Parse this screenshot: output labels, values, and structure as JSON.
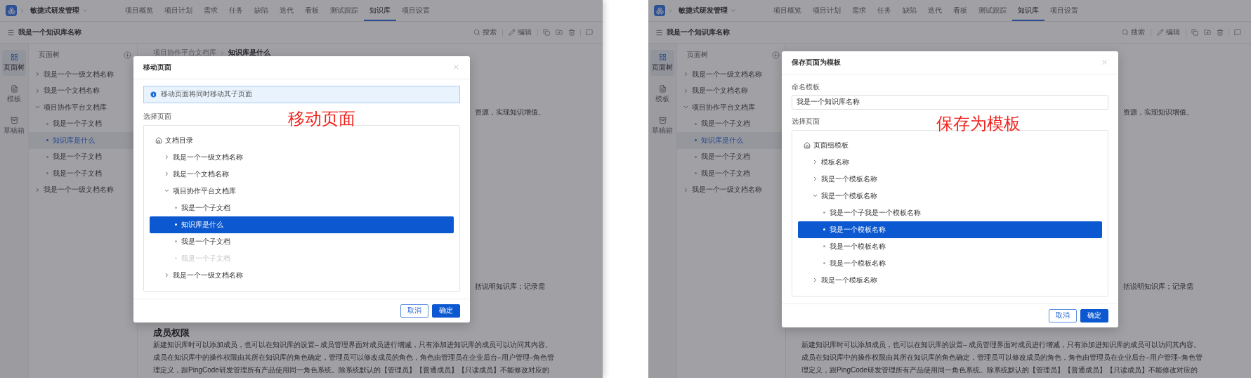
{
  "screens": [
    {
      "app_bar": {
        "product": "敏捷式研发管理",
        "nav": [
          {
            "label": "项目概览",
            "selected": false
          },
          {
            "label": "项目计划",
            "selected": false
          },
          {
            "label": "需求",
            "selected": false
          },
          {
            "label": "任务",
            "selected": false
          },
          {
            "label": "缺陷",
            "selected": false
          },
          {
            "label": "迭代",
            "selected": false
          },
          {
            "label": "看板",
            "selected": false
          },
          {
            "label": "测试跟踪",
            "selected": false
          },
          {
            "label": "知识库",
            "selected": true
          },
          {
            "label": "项目设置",
            "selected": false
          }
        ]
      },
      "toolbar": {
        "title": "我是一个知识库名称",
        "actions": [
          {
            "label": "搜索",
            "kind": "search"
          },
          {
            "label": "编辑",
            "kind": "edit"
          }
        ]
      },
      "rail": [
        {
          "label": "页面树",
          "kind": "tree",
          "selected": true
        },
        {
          "label": "模板",
          "kind": "template",
          "selected": false
        },
        {
          "label": "草稿箱",
          "kind": "drafts",
          "selected": false
        }
      ],
      "tree_panel": {
        "title": "页面树",
        "items": [
          {
            "label": "我是一个一级文档名称",
            "kind": "branch",
            "expanded": false,
            "selected": false
          },
          {
            "label": "我是一个文档名称",
            "kind": "branch",
            "expanded": false,
            "selected": false
          },
          {
            "label": "项目协作平台文档库",
            "kind": "branch",
            "expanded": true,
            "selected": false,
            "children": [
              {
                "label": "我是一个子文档",
                "kind": "leaf",
                "selected": false
              },
              {
                "label": "知识库是什么",
                "kind": "leaf",
                "selected": true
              },
              {
                "label": "我是一个子文档",
                "kind": "leaf",
                "selected": false
              },
              {
                "label": "我是一个子文档",
                "kind": "leaf",
                "selected": false
              }
            ]
          },
          {
            "label": "我是一个一级文档名称",
            "kind": "branch",
            "expanded": false,
            "selected": false
          }
        ]
      },
      "content": {
        "breadcrumb": [
          "项目协作平台文档库",
          "知识库是什么"
        ],
        "fragments": [
          "资源，实现知识增值。",
          "括说明知识库；记录需"
        ],
        "heading": "成员权限",
        "paragraph": [
          "新建知识库时可以添加成员，也可以在知识库的设置– 成员管理界面对成员进行增减，只有添加进知识库的成员可以访问其内容。",
          "成员在知识库中的操作权限由其所在知识库的角色确定，管理员可以修改成员的角色，角色由管理员在企业后台–用户管理–角色管",
          "理定义，跟PingCode研发管理所有产品使用同一角色系统。除系统默认的【管理员】【普通成员】【只读成员】不能修改对应的"
        ]
      },
      "dialog": {
        "title": "移动页面",
        "alert": "移动页面将同时移动其子页面",
        "tree_label": "选择页面",
        "annotation": "移动页面",
        "tree": {
          "label": "文档目录",
          "kind": "root",
          "selected": false,
          "disabled": false,
          "children": [
            {
              "label": "我是一个一级文档名称",
              "kind": "branch",
              "expanded": false,
              "selected": false,
              "disabled": false
            },
            {
              "label": "我是一个文档名称",
              "kind": "branch",
              "expanded": false,
              "selected": false,
              "disabled": false
            },
            {
              "label": "项目协作平台文档库",
              "kind": "branch",
              "expanded": true,
              "selected": false,
              "disabled": false,
              "children": [
                {
                  "label": "我是一个子文档",
                  "kind": "leaf",
                  "selected": false,
                  "disabled": false
                },
                {
                  "label": "知识库是什么",
                  "kind": "leaf",
                  "selected": true,
                  "disabled": false
                },
                {
                  "label": "我是一个子文档",
                  "kind": "leaf",
                  "selected": false,
                  "disabled": false
                },
                {
                  "label": "我是一个子文档",
                  "kind": "leaf",
                  "selected": false,
                  "disabled": true
                }
              ]
            },
            {
              "label": "我是一个一级文档名称",
              "kind": "branch",
              "expanded": false,
              "selected": false,
              "disabled": false
            }
          ]
        },
        "buttons": [
          {
            "label": "取消",
            "kind": "secondary"
          },
          {
            "label": "确定",
            "kind": "primary"
          }
        ]
      }
    },
    {
      "app_bar": {
        "product": "敏捷式研发管理",
        "nav": [
          {
            "label": "项目概览",
            "selected": false
          },
          {
            "label": "项目计划",
            "selected": false
          },
          {
            "label": "需求",
            "selected": false
          },
          {
            "label": "任务",
            "selected": false
          },
          {
            "label": "缺陷",
            "selected": false
          },
          {
            "label": "迭代",
            "selected": false
          },
          {
            "label": "看板",
            "selected": false
          },
          {
            "label": "测试跟踪",
            "selected": false
          },
          {
            "label": "知识库",
            "selected": true
          },
          {
            "label": "项目设置",
            "selected": false
          }
        ]
      },
      "toolbar": {
        "title": "我是一个知识库名称",
        "actions": [
          {
            "label": "搜索",
            "kind": "search"
          },
          {
            "label": "编辑",
            "kind": "edit"
          }
        ]
      },
      "rail": [
        {
          "label": "页面树",
          "kind": "tree",
          "selected": true
        },
        {
          "label": "模板",
          "kind": "template",
          "selected": false
        },
        {
          "label": "草稿箱",
          "kind": "drafts",
          "selected": false
        }
      ],
      "tree_panel": {
        "title": "页面树",
        "items": [
          {
            "label": "我是一个一级文档名称",
            "kind": "branch",
            "expanded": false,
            "selected": false
          },
          {
            "label": "我是一个文档名称",
            "kind": "branch",
            "expanded": false,
            "selected": false
          },
          {
            "label": "项目协作平台文档库",
            "kind": "branch",
            "expanded": true,
            "selected": false,
            "children": [
              {
                "label": "我是一个子文档",
                "kind": "leaf",
                "selected": false
              },
              {
                "label": "知识库是什么",
                "kind": "leaf",
                "selected": true
              },
              {
                "label": "我是一个子文档",
                "kind": "leaf",
                "selected": false
              },
              {
                "label": "我是一个子文档",
                "kind": "leaf",
                "selected": false
              }
            ]
          },
          {
            "label": "我是一个一级文档名称",
            "kind": "branch",
            "expanded": false,
            "selected": false
          }
        ]
      },
      "content": {
        "fragments": [
          "资源，实现知识增值。",
          "括说明知识库；记录需"
        ],
        "paragraph": [
          "新建知识库时可以添加成员，也可以在知识库的设置– 成员管理界面对成员进行增减，只有添加进知识库的成员可以访问其内容。",
          "成员在知识库中的操作权限由其所在知识库的角色确定，管理员可以修改成员的角色，角色由管理员在企业后台–用户管理–角色管",
          "理定义，跟PingCode研发管理所有产品使用同一角色系统。除系统默认的【管理员】【普通成员】【只读成员】不能修改对应的"
        ]
      },
      "dialog": {
        "title": "保存页面为模板",
        "name_label": "命名模板",
        "name_value": "我是一个知识库名称",
        "tree_label": "选择页面",
        "annotation": "保存为模板",
        "tree": {
          "label": "页面组模板",
          "kind": "root",
          "selected": false,
          "disabled": false,
          "children": [
            {
              "label": "模板名称",
              "kind": "branch",
              "expanded": false,
              "selected": false,
              "disabled": false
            },
            {
              "label": "我是一个模板名称",
              "kind": "branch",
              "expanded": false,
              "selected": false,
              "disabled": false
            },
            {
              "label": "我是一个模板名称",
              "kind": "branch",
              "expanded": true,
              "selected": false,
              "disabled": false,
              "children": [
                {
                  "label": "我是一个子我是一个模板名称",
                  "kind": "leaf",
                  "selected": false,
                  "disabled": false
                },
                {
                  "label": "我是一个模板名称",
                  "kind": "leaf",
                  "selected": true,
                  "disabled": false
                },
                {
                  "label": "我是一个模板名称",
                  "kind": "leaf",
                  "selected": false,
                  "disabled": false
                },
                {
                  "label": "我是一个模板名称",
                  "kind": "leaf",
                  "selected": false,
                  "disabled": false
                }
              ]
            },
            {
              "label": "我是一个模板名称",
              "kind": "branch",
              "expanded": false,
              "selected": false,
              "disabled": false
            }
          ]
        },
        "buttons": [
          {
            "label": "取消",
            "kind": "secondary"
          },
          {
            "label": "确定",
            "kind": "primary"
          }
        ]
      }
    }
  ]
}
